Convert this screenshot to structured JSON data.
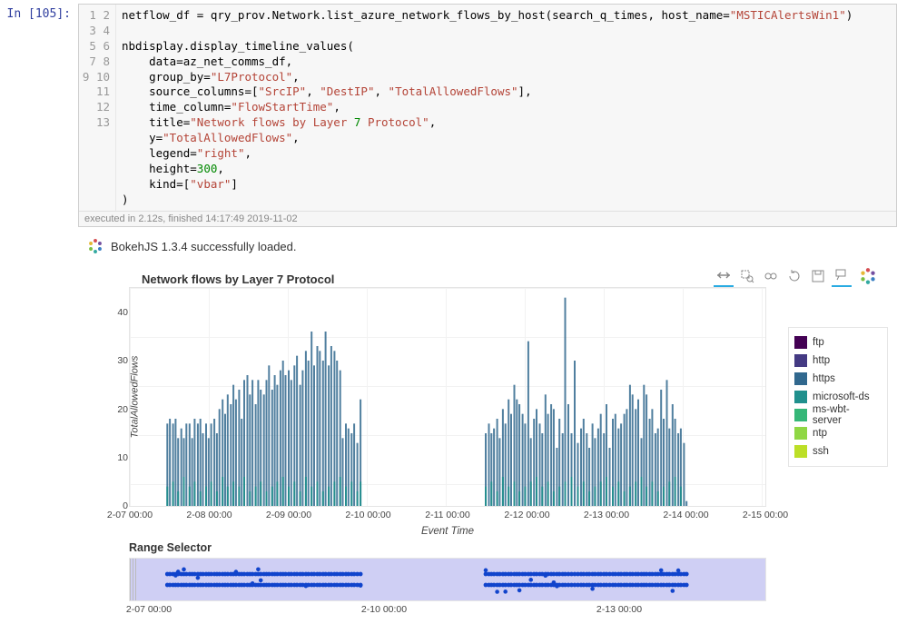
{
  "prompt": "In [105]:",
  "code_lines": [
    "netflow_df = qry_prov.Network.list_azure_network_flows_by_host(search_q_times, host_name=\"MSTICAlertsWin1\")",
    "",
    "nbdisplay.display_timeline_values(",
    "    data=az_net_comms_df,",
    "    group_by=\"L7Protocol\",",
    "    source_columns=[\"SrcIP\", \"DestIP\", \"TotalAllowedFlows\"],",
    "    time_column=\"FlowStartTime\",",
    "    title=\"Network flows by Layer 7 Protocol\",",
    "    y=\"TotalAllowedFlows\",",
    "    legend=\"right\",",
    "    height=300,",
    "    kind=[\"vbar\"]",
    ")"
  ],
  "gutter_lines": [
    "1",
    "2",
    "3",
    "4",
    "5",
    "6",
    "7",
    "8",
    "9",
    "10",
    "11",
    "12",
    "13"
  ],
  "exec_info": "executed in 2.12s, finished 14:17:49 2019-11-02",
  "bokeh_loaded": "BokehJS 1.3.4 successfully loaded.",
  "chart_data": {
    "type": "bar",
    "title": "Network flows by Layer 7 Protocol",
    "xlabel": "Event Time",
    "ylabel": "TotalAllowedFlows",
    "ylim": [
      0,
      45
    ],
    "y_ticks": [
      0,
      10,
      20,
      30,
      40
    ],
    "x_ticks": [
      "2-07 00:00",
      "2-08 00:00",
      "2-09 00:00",
      "2-10 00:00",
      "2-11 00:00",
      "2-12 00:00",
      "2-13 00:00",
      "2-14 00:00",
      "2-15 00:00"
    ],
    "series": [
      {
        "name": "ftp",
        "color": "#440154"
      },
      {
        "name": "http",
        "color": "#443a83"
      },
      {
        "name": "https",
        "color": "#31688e"
      },
      {
        "name": "microsoft-ds",
        "color": "#20908d"
      },
      {
        "name": "ms-wbt-server",
        "color": "#35b778"
      },
      {
        "name": "ntp",
        "color": "#8fd744"
      },
      {
        "name": "ssh",
        "color": "#bcdf27"
      }
    ],
    "bars_https": [
      [
        0.059,
        17
      ],
      [
        0.063,
        18
      ],
      [
        0.068,
        17
      ],
      [
        0.072,
        18
      ],
      [
        0.076,
        14
      ],
      [
        0.081,
        16
      ],
      [
        0.085,
        14
      ],
      [
        0.089,
        17
      ],
      [
        0.094,
        17
      ],
      [
        0.098,
        14
      ],
      [
        0.102,
        18
      ],
      [
        0.107,
        17
      ],
      [
        0.111,
        18
      ],
      [
        0.115,
        15
      ],
      [
        0.12,
        17
      ],
      [
        0.124,
        14
      ],
      [
        0.128,
        17
      ],
      [
        0.133,
        18
      ],
      [
        0.137,
        15
      ],
      [
        0.141,
        20
      ],
      [
        0.146,
        22
      ],
      [
        0.15,
        19
      ],
      [
        0.154,
        23
      ],
      [
        0.159,
        21
      ],
      [
        0.163,
        25
      ],
      [
        0.167,
        22
      ],
      [
        0.172,
        24
      ],
      [
        0.176,
        18
      ],
      [
        0.18,
        26
      ],
      [
        0.185,
        27
      ],
      [
        0.189,
        23
      ],
      [
        0.193,
        26
      ],
      [
        0.198,
        21
      ],
      [
        0.202,
        26
      ],
      [
        0.206,
        24
      ],
      [
        0.211,
        23
      ],
      [
        0.215,
        26
      ],
      [
        0.219,
        29
      ],
      [
        0.224,
        24
      ],
      [
        0.228,
        27
      ],
      [
        0.232,
        25
      ],
      [
        0.237,
        28
      ],
      [
        0.241,
        30
      ],
      [
        0.245,
        27
      ],
      [
        0.25,
        28
      ],
      [
        0.254,
        26
      ],
      [
        0.259,
        29
      ],
      [
        0.263,
        31
      ],
      [
        0.268,
        25
      ],
      [
        0.272,
        28
      ],
      [
        0.277,
        32
      ],
      [
        0.281,
        30
      ],
      [
        0.286,
        36
      ],
      [
        0.29,
        29
      ],
      [
        0.295,
        33
      ],
      [
        0.299,
        32
      ],
      [
        0.304,
        30
      ],
      [
        0.308,
        36
      ],
      [
        0.313,
        29
      ],
      [
        0.317,
        33
      ],
      [
        0.322,
        32
      ],
      [
        0.326,
        30
      ],
      [
        0.331,
        28
      ],
      [
        0.335,
        14
      ],
      [
        0.34,
        17
      ],
      [
        0.344,
        16
      ],
      [
        0.349,
        15
      ],
      [
        0.353,
        17
      ],
      [
        0.358,
        13
      ],
      [
        0.363,
        22
      ],
      [
        0.56,
        15
      ],
      [
        0.565,
        17
      ],
      [
        0.569,
        15
      ],
      [
        0.573,
        16
      ],
      [
        0.578,
        18
      ],
      [
        0.582,
        14
      ],
      [
        0.587,
        20
      ],
      [
        0.591,
        17
      ],
      [
        0.596,
        22
      ],
      [
        0.6,
        19
      ],
      [
        0.605,
        25
      ],
      [
        0.609,
        22
      ],
      [
        0.613,
        21
      ],
      [
        0.618,
        19
      ],
      [
        0.622,
        17
      ],
      [
        0.627,
        34
      ],
      [
        0.631,
        14
      ],
      [
        0.636,
        18
      ],
      [
        0.64,
        20
      ],
      [
        0.645,
        17
      ],
      [
        0.649,
        15
      ],
      [
        0.654,
        23
      ],
      [
        0.658,
        19
      ],
      [
        0.663,
        21
      ],
      [
        0.667,
        20
      ],
      [
        0.672,
        12
      ],
      [
        0.676,
        18
      ],
      [
        0.681,
        15
      ],
      [
        0.685,
        43
      ],
      [
        0.69,
        21
      ],
      [
        0.695,
        15
      ],
      [
        0.7,
        30
      ],
      [
        0.705,
        13
      ],
      [
        0.71,
        16
      ],
      [
        0.714,
        18
      ],
      [
        0.719,
        15
      ],
      [
        0.723,
        12
      ],
      [
        0.728,
        17
      ],
      [
        0.732,
        14
      ],
      [
        0.737,
        16
      ],
      [
        0.741,
        19
      ],
      [
        0.746,
        15
      ],
      [
        0.75,
        21
      ],
      [
        0.755,
        12
      ],
      [
        0.76,
        18
      ],
      [
        0.764,
        19
      ],
      [
        0.769,
        16
      ],
      [
        0.773,
        17
      ],
      [
        0.778,
        19
      ],
      [
        0.782,
        20
      ],
      [
        0.787,
        25
      ],
      [
        0.791,
        23
      ],
      [
        0.796,
        20
      ],
      [
        0.8,
        22
      ],
      [
        0.805,
        14
      ],
      [
        0.809,
        25
      ],
      [
        0.813,
        23
      ],
      [
        0.818,
        18
      ],
      [
        0.822,
        20
      ],
      [
        0.827,
        15
      ],
      [
        0.831,
        16
      ],
      [
        0.836,
        24
      ],
      [
        0.84,
        18
      ],
      [
        0.845,
        26
      ],
      [
        0.849,
        16
      ],
      [
        0.854,
        21
      ],
      [
        0.858,
        18
      ],
      [
        0.863,
        15
      ],
      [
        0.867,
        16
      ],
      [
        0.872,
        13
      ],
      [
        0.876,
        1
      ]
    ],
    "bars_msds": [
      [
        0.059,
        4
      ],
      [
        0.068,
        5
      ],
      [
        0.076,
        3
      ],
      [
        0.085,
        6
      ],
      [
        0.094,
        4
      ],
      [
        0.102,
        5
      ],
      [
        0.111,
        3
      ],
      [
        0.12,
        4
      ],
      [
        0.128,
        5
      ],
      [
        0.137,
        3
      ],
      [
        0.146,
        6
      ],
      [
        0.154,
        4
      ],
      [
        0.163,
        5
      ],
      [
        0.172,
        4
      ],
      [
        0.18,
        6
      ],
      [
        0.189,
        3
      ],
      [
        0.198,
        4
      ],
      [
        0.206,
        5
      ],
      [
        0.215,
        3
      ],
      [
        0.224,
        4
      ],
      [
        0.232,
        5
      ],
      [
        0.241,
        6
      ],
      [
        0.25,
        4
      ],
      [
        0.259,
        5
      ],
      [
        0.268,
        3
      ],
      [
        0.277,
        6
      ],
      [
        0.286,
        4
      ],
      [
        0.295,
        5
      ],
      [
        0.304,
        3
      ],
      [
        0.313,
        4
      ],
      [
        0.322,
        5
      ],
      [
        0.331,
        6
      ],
      [
        0.34,
        4
      ],
      [
        0.349,
        5
      ],
      [
        0.358,
        3
      ],
      [
        0.363,
        5
      ],
      [
        0.56,
        4
      ],
      [
        0.569,
        5
      ],
      [
        0.578,
        3
      ],
      [
        0.587,
        6
      ],
      [
        0.596,
        4
      ],
      [
        0.605,
        5
      ],
      [
        0.613,
        3
      ],
      [
        0.622,
        4
      ],
      [
        0.631,
        5
      ],
      [
        0.64,
        6
      ],
      [
        0.649,
        4
      ],
      [
        0.658,
        5
      ],
      [
        0.667,
        3
      ],
      [
        0.676,
        4
      ],
      [
        0.685,
        5
      ],
      [
        0.695,
        6
      ],
      [
        0.705,
        4
      ],
      [
        0.714,
        5
      ],
      [
        0.723,
        3
      ],
      [
        0.732,
        4
      ],
      [
        0.741,
        5
      ],
      [
        0.75,
        6
      ],
      [
        0.76,
        4
      ],
      [
        0.769,
        5
      ],
      [
        0.778,
        3
      ],
      [
        0.787,
        4
      ],
      [
        0.796,
        5
      ],
      [
        0.805,
        6
      ],
      [
        0.813,
        4
      ],
      [
        0.822,
        5
      ],
      [
        0.831,
        3
      ],
      [
        0.84,
        4
      ],
      [
        0.849,
        5
      ],
      [
        0.858,
        6
      ],
      [
        0.867,
        4
      ]
    ]
  },
  "range_selector": {
    "title": "Range Selector",
    "x_ticks": [
      "2-07 00:00",
      "2-10 00:00",
      "2-13 00:00"
    ]
  }
}
